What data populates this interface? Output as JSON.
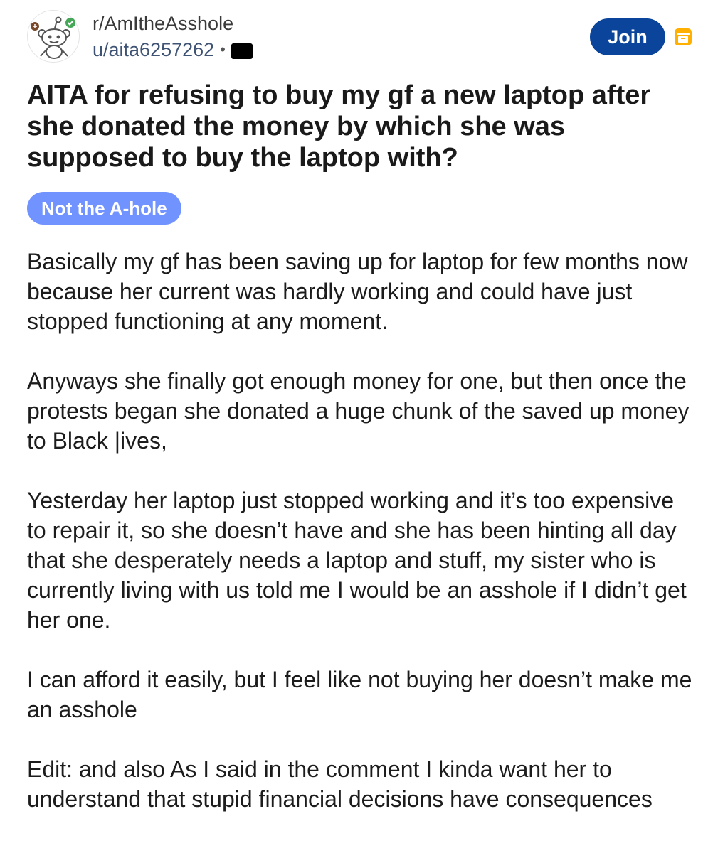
{
  "header": {
    "subreddit": "r/AmItheAsshole",
    "username": "u/aita6257262",
    "separator": "•",
    "join_label": "Join",
    "avatar_icon": "reddit-snoo-icon",
    "archive_icon": "archive-icon"
  },
  "post": {
    "title": "AITA for refusing to buy my gf a new laptop after she donated the money by which she was supposed to buy the laptop with?",
    "flair": "Not the A-hole",
    "paragraphs": [
      "Basically my gf has been saving up for laptop for few months now because her current was hardly working and could have just stopped functioning at any moment.",
      "Anyways she finally got enough money for one, but then once the protests began she donated a huge chunk of the saved up money to Black |ives,",
      "Yesterday her laptop just stopped working and it’s too expensive to repair it, so she doesn’t have and she has been hinting all day that she desperately needs a laptop and stuff, my sister who is currently living with us told me I would be an asshole if I didn’t get her one.",
      "I can afford it easily, but I feel like not buying her doesn’t make me an asshole",
      "Edit: and also As I said in the comment I kinda want her to understand that stupid financial decisions have consequences"
    ]
  },
  "colors": {
    "join_button": "#0a449b",
    "flair_bg": "#7193ff",
    "archive_icon": "#ffb000",
    "username": "#3f5375"
  }
}
